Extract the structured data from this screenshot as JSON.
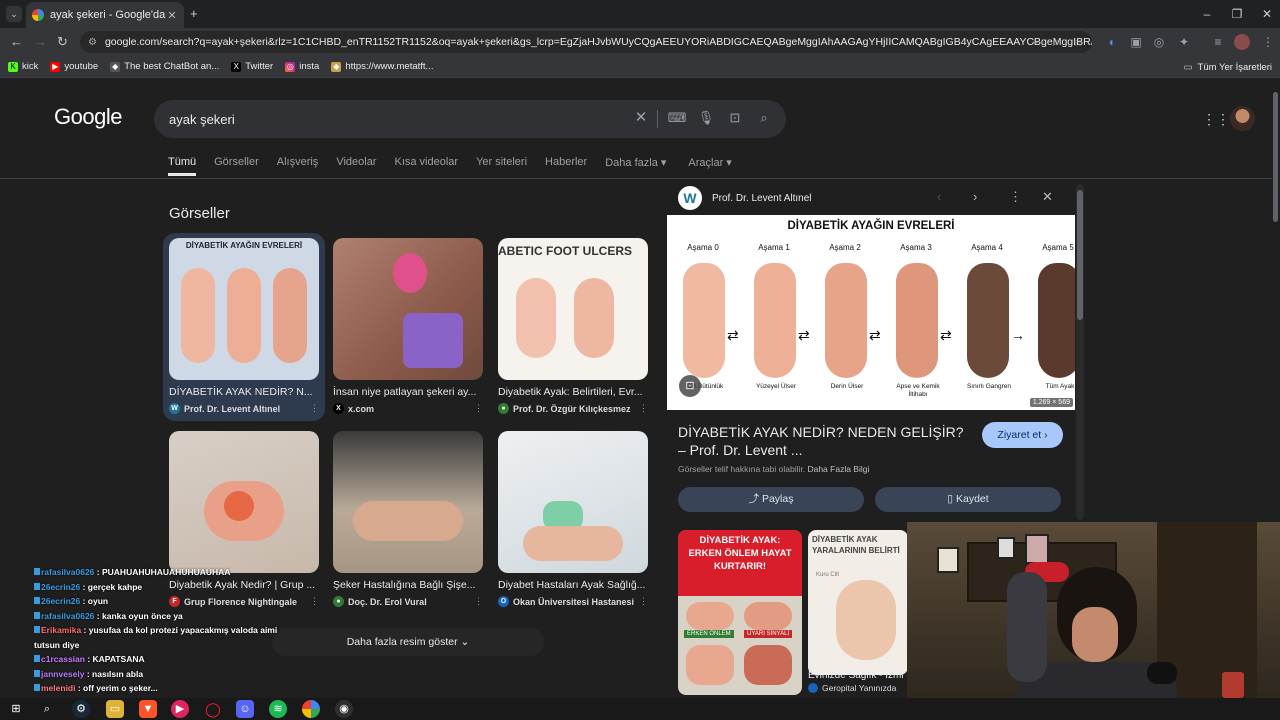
{
  "browser": {
    "tab_title": "ayak şekeri - Google'da Ara",
    "url": "google.com/search?q=ayak+şekeri&rlz=1C1CHBD_enTR1152TR1152&oq=ayak+şekeri&gs_lcrp=EgZjaHJvbWUyCQgAEEUYORiABDIGCAEQABgeMggIAhAAGAgYHjIICAMQABgIGB4yCAgEEAAYCBgeMggIBRAAGAgYHjIICAY...",
    "bookmarks": [
      "kick",
      "youtube",
      "The best ChatBot an...",
      "Twitter",
      "insta",
      "https://www.metatft..."
    ],
    "all_bookmarks": "Tüm Yer İşaretleri"
  },
  "google": {
    "logo": "Google",
    "query": "ayak şekeri",
    "tabs": [
      "Tümü",
      "Görseller",
      "Alışveriş",
      "Videolar",
      "Kısa videolar",
      "Yer siteleri",
      "Haberler",
      "Daha fazla",
      "Araçlar"
    ],
    "section_title": "Görseller",
    "more_images": "Daha fazla resim göster",
    "results": [
      {
        "title": "DİYABETİK AYAK NEDİR? N...",
        "source": "Prof. Dr. Levent Altınel"
      },
      {
        "title": "İnsan niye patlayan şekeri ay...",
        "source": "x.com"
      },
      {
        "title": "Diyabetik Ayak: Belirtileri, Evr...",
        "source": "Prof. Dr. Özgür Kılıçkesmez"
      },
      {
        "title": "Diyabetik Ayak Nedir? | Grup ...",
        "source": "Grup Florence Nightingale"
      },
      {
        "title": "Şeker Hastalığına Bağlı Şişe...",
        "source": "Doç. Dr. Erol Vural"
      },
      {
        "title": "Diyabet Hastaları Ayak Sağlığ...",
        "source": "Okan Üniversitesi Hastanesi"
      }
    ],
    "thumb_texts": {
      "t1_head": "DİYABETİK AYAĞIN EVRELERİ",
      "t3_head": "ABETIC FOOT ULCERS"
    }
  },
  "panel": {
    "site": "Prof. Dr. Levent Altınel",
    "image_title": "DİYABETİK AYAĞIN EVRELERİ",
    "stages": [
      "Aşama 0",
      "Aşama 1",
      "Aşama 2",
      "Aşama 3",
      "Aşama 4",
      "Aşama 5"
    ],
    "stage_captions": [
      "Cilt Bütünlük",
      "Yüzeyel Ülser",
      "Derin Ülser",
      "Apse ve Kemik İltihabı",
      "Sınırlı Gangren",
      "Tüm Ayak"
    ],
    "dimensions": "1.269 × 569",
    "title": "DİYABETİK AYAK NEDİR? NEDEN GELİŞİR? – Prof. Dr. Levent ...",
    "visit": "Ziyaret et",
    "copyright": "Görseller telif hakkına tabi olabilir.",
    "learn_more": "Daha Fazla Bilgi",
    "share": "Paylaş",
    "save": "Kaydet",
    "related": [
      {
        "head": "DİYABETİK AYAK: ERKEN ÖNLEM HAYAT KURTARIR!",
        "sub1": "ERKEN ÖNLEM",
        "sub2": "UYARI SİNYALİ"
      },
      {
        "head": "DİYABETİK AYAK YARALARININ BELİRTİ",
        "title": "Evinizde Sağlık - İzmi",
        "source": "Geropital Yanınızda",
        "tag": "Kuru Cilt"
      }
    ]
  },
  "chat": [
    {
      "user": "rafasilva0626",
      "color": "#3a9be0",
      "msg": "PUAHUAHUHAUAHUHUAUHAA"
    },
    {
      "user": "26ecrin26",
      "color": "#3a9be0",
      "msg": "gerçek kahpe"
    },
    {
      "user": "26ecrin26",
      "color": "#3a9be0",
      "msg": "oyun"
    },
    {
      "user": "rafasilva0626",
      "color": "#3a9be0",
      "msg": "kanka oyun önce ya"
    },
    {
      "user": "Erikamika",
      "color": "#ff6b6b",
      "msg": "yusufaa da kol protezi yapacakmış valoda aimi tutsun diye"
    },
    {
      "user": "c1rcassian",
      "color": "#c879ff",
      "msg": "KAPATSANA"
    },
    {
      "user": "jannvesely",
      "color": "#b07cff",
      "msg": "nasılsın abla"
    },
    {
      "user": "melenidi",
      "color": "#ff7a7a",
      "msg": "off yerim o şeker..."
    }
  ]
}
